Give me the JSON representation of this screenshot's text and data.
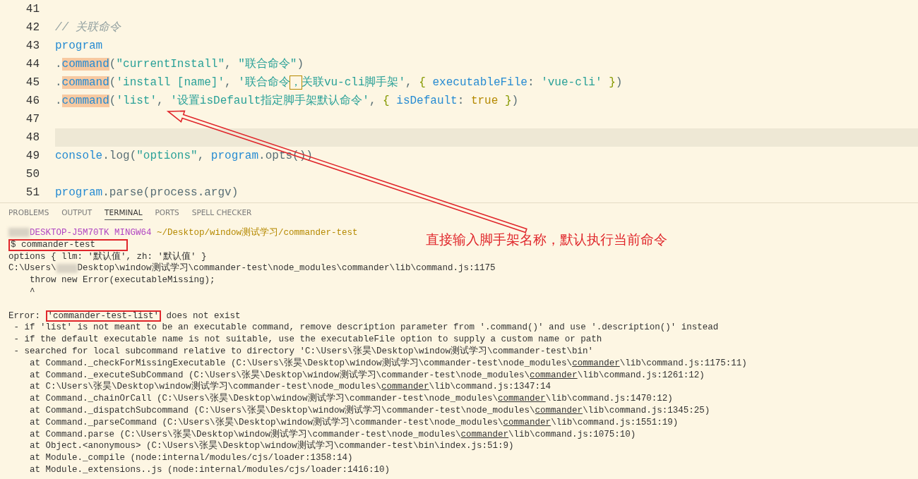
{
  "editor": {
    "lines": [
      {
        "number": "41"
      },
      {
        "number": "42",
        "current": false,
        "tokens": [
          {
            "kind": "comment",
            "text": "// 关联命令"
          }
        ]
      },
      {
        "number": "43",
        "current": false,
        "tokens": [
          {
            "kind": "ident",
            "text": "program"
          }
        ]
      },
      {
        "number": "44",
        "current": false,
        "tokens": [
          {
            "kind": "plain",
            "text": "."
          },
          {
            "kind": "match",
            "text": "command"
          },
          {
            "kind": "plain",
            "text": "("
          },
          {
            "kind": "string",
            "text": "\"currentInstall\""
          },
          {
            "kind": "plain",
            "text": ", "
          },
          {
            "kind": "string",
            "text": "\"联合命令\""
          },
          {
            "kind": "plain",
            "text": ")"
          }
        ]
      },
      {
        "number": "45",
        "current": false,
        "tokens": [
          {
            "kind": "plain",
            "text": "."
          },
          {
            "kind": "match",
            "text": "command"
          },
          {
            "kind": "plain",
            "text": "("
          },
          {
            "kind": "string",
            "text": "'install [name]'"
          },
          {
            "kind": "plain",
            "text": ", "
          },
          {
            "kind": "string",
            "text": "'联合命令"
          },
          {
            "kind": "bracket",
            "text": "，"
          },
          {
            "kind": "string",
            "text": "关联vu-cli脚手架'"
          },
          {
            "kind": "plain",
            "text": ", "
          },
          {
            "kind": "brace",
            "text": "{ "
          },
          {
            "kind": "key",
            "text": "executableFile"
          },
          {
            "kind": "plain",
            "text": ": "
          },
          {
            "kind": "string",
            "text": "'vue-cli'"
          },
          {
            "kind": "brace",
            "text": " }"
          },
          {
            "kind": "plain",
            "text": ")"
          }
        ]
      },
      {
        "number": "46",
        "current": false,
        "tokens": [
          {
            "kind": "plain",
            "text": "."
          },
          {
            "kind": "match",
            "text": "command"
          },
          {
            "kind": "plain",
            "text": "("
          },
          {
            "kind": "string",
            "text": "'list'"
          },
          {
            "kind": "plain",
            "text": ", "
          },
          {
            "kind": "string",
            "text": "'设置isDefault指定脚手架默认命令'"
          },
          {
            "kind": "plain",
            "text": ", "
          },
          {
            "kind": "brace",
            "text": "{ "
          },
          {
            "kind": "key",
            "text": "isDefault"
          },
          {
            "kind": "plain",
            "text": ": "
          },
          {
            "kind": "keyword",
            "text": "true"
          },
          {
            "kind": "brace",
            "text": " }"
          },
          {
            "kind": "plain",
            "text": ")"
          }
        ]
      },
      {
        "number": "47"
      },
      {
        "number": "48",
        "current": true
      },
      {
        "number": "49",
        "current": false,
        "tokens": [
          {
            "kind": "ident",
            "text": "console"
          },
          {
            "kind": "plain",
            "text": ".log("
          },
          {
            "kind": "string",
            "text": "\"options\""
          },
          {
            "kind": "plain",
            "text": ", "
          },
          {
            "kind": "ident",
            "text": "program"
          },
          {
            "kind": "plain",
            "text": ".opts())"
          }
        ]
      },
      {
        "number": "50"
      },
      {
        "number": "51",
        "current": false,
        "tokens": [
          {
            "kind": "ident",
            "text": "program"
          },
          {
            "kind": "plain",
            "text": ".parse(process.argv)"
          }
        ]
      }
    ]
  },
  "panel": {
    "tabs": [
      {
        "label": "PROBLEMS",
        "selected": false
      },
      {
        "label": "OUTPUT",
        "selected": false
      },
      {
        "label": "TERMINAL",
        "selected": true
      },
      {
        "label": "PORTS",
        "selected": false
      },
      {
        "label": "SPELL CHECKER",
        "selected": false
      }
    ],
    "lines": [
      {
        "tokens": [
          {
            "kind": "redacted"
          },
          {
            "kind": "host",
            "text": "DESKTOP-J5M70TK MINGW64"
          },
          {
            "kind": "path",
            "text": " ~/Desktop/window测试学习/commander-test"
          }
        ]
      },
      {
        "tokens": [
          {
            "kind": "marked-wide",
            "text": "$ commander-test"
          }
        ]
      },
      {
        "tokens": [
          {
            "kind": "text",
            "text": "options { llm: '默认值', zh: '默认值' }"
          }
        ]
      },
      {
        "tokens": [
          {
            "kind": "text",
            "text": "C:\\Users\\"
          },
          {
            "kind": "redacted"
          },
          {
            "kind": "text",
            "text": "Desktop\\window测试学习\\commander-test\\node_modules\\commander\\lib\\command.js:1175"
          }
        ]
      },
      {
        "tokens": [
          {
            "kind": "text",
            "text": "    throw new Error(executableMissing);"
          }
        ]
      },
      {
        "tokens": [
          {
            "kind": "text",
            "text": "    ^"
          }
        ]
      },
      {
        "kind": "blank"
      },
      {
        "tokens": [
          {
            "kind": "text",
            "text": "Error: "
          },
          {
            "kind": "marked",
            "text": "'commander-test-list'"
          },
          {
            "kind": "text",
            "text": " does not exist"
          }
        ]
      },
      {
        "tokens": [
          {
            "kind": "text",
            "text": " - if 'list' is not meant to be an executable command, remove description parameter from '.command()' and use '.description()' instead"
          }
        ]
      },
      {
        "tokens": [
          {
            "kind": "text",
            "text": " - if the default executable name is not suitable, use the executableFile option to supply a custom name or path"
          }
        ]
      },
      {
        "tokens": [
          {
            "kind": "text",
            "text": " - searched for local subcommand relative to directory 'C:\\Users\\张昊\\Desktop\\window测试学习\\commander-test\\bin'"
          }
        ]
      },
      {
        "tokens": [
          {
            "kind": "text",
            "text": "    at Command._checkForMissingExecutable (C:\\Users\\张昊\\Desktop\\window测试学习\\commander-test\\node_modules\\"
          },
          {
            "kind": "link",
            "text": "commander"
          },
          {
            "kind": "text",
            "text": "\\lib\\command.js:1175:11)"
          }
        ]
      },
      {
        "tokens": [
          {
            "kind": "text",
            "text": "    at Command._executeSubCommand (C:\\Users\\张昊\\Desktop\\window测试学习\\commander-test\\node_modules\\"
          },
          {
            "kind": "link",
            "text": "commander"
          },
          {
            "kind": "text",
            "text": "\\lib\\command.js:1261:12)"
          }
        ]
      },
      {
        "tokens": [
          {
            "kind": "text",
            "text": "    at C:\\Users\\张昊\\Desktop\\window测试学习\\commander-test\\node_modules\\"
          },
          {
            "kind": "link",
            "text": "commander"
          },
          {
            "kind": "text",
            "text": "\\lib\\command.js:1347:14"
          }
        ]
      },
      {
        "tokens": [
          {
            "kind": "text",
            "text": "    at Command._chainOrCall (C:\\Users\\张昊\\Desktop\\window测试学习\\commander-test\\node_modules\\"
          },
          {
            "kind": "link",
            "text": "commander"
          },
          {
            "kind": "text",
            "text": "\\lib\\command.js:1470:12)"
          }
        ]
      },
      {
        "tokens": [
          {
            "kind": "text",
            "text": "    at Command._dispatchSubcommand (C:\\Users\\张昊\\Desktop\\window测试学习\\commander-test\\node_modules\\"
          },
          {
            "kind": "link",
            "text": "commander"
          },
          {
            "kind": "text",
            "text": "\\lib\\command.js:1345:25)"
          }
        ]
      },
      {
        "tokens": [
          {
            "kind": "text",
            "text": "    at Command._parseCommand (C:\\Users\\张昊\\Desktop\\window测试学习\\commander-test\\node_modules\\"
          },
          {
            "kind": "link",
            "text": "commander"
          },
          {
            "kind": "text",
            "text": "\\lib\\command.js:1551:19)"
          }
        ]
      },
      {
        "tokens": [
          {
            "kind": "text",
            "text": "    at Command.parse (C:\\Users\\张昊\\Desktop\\window测试学习\\commander-test\\node_modules\\"
          },
          {
            "kind": "link",
            "text": "commander"
          },
          {
            "kind": "text",
            "text": "\\lib\\command.js:1075:10)"
          }
        ]
      },
      {
        "tokens": [
          {
            "kind": "text",
            "text": "    at Object.<anonymous> (C:\\Users\\张昊\\Desktop\\window测试学习\\commander-test\\bin\\index.js:51:9)"
          }
        ]
      },
      {
        "tokens": [
          {
            "kind": "text",
            "text": "    at Module._compile (node:internal/modules/cjs/loader:1358:14)"
          }
        ]
      },
      {
        "tokens": [
          {
            "kind": "text",
            "text": "    at Module._extensions..js (node:internal/modules/cjs/loader:1416:10)"
          }
        ]
      }
    ]
  },
  "annotation": {
    "text": "直接输入脚手架名称，默认执行当前命令"
  }
}
